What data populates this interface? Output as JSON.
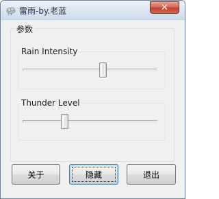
{
  "window": {
    "title": "雷雨-by.老蓝",
    "close_label": "✕"
  },
  "params_group": {
    "label": "参数"
  },
  "rain": {
    "label": "Rain Intensity",
    "value_fraction": 0.6
  },
  "thunder": {
    "label": "Thunder Level",
    "value_fraction": 0.3
  },
  "buttons": {
    "about": "关于",
    "hide": "隐藏",
    "exit": "退出"
  }
}
